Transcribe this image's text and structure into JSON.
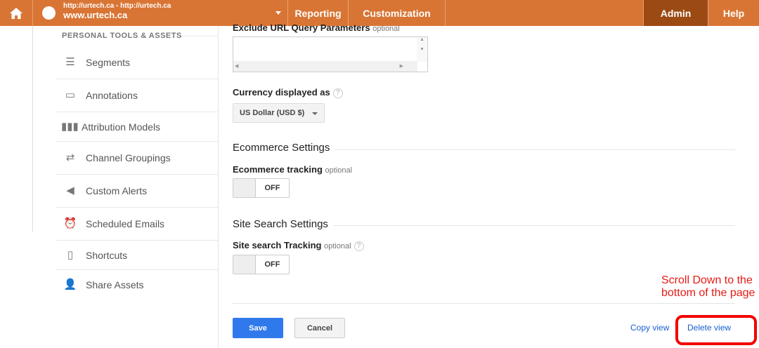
{
  "topbar": {
    "account_line1": "http://urtech.ca - http://urtech.ca",
    "account_line2": "www.urtech.ca",
    "nav": [
      "Reporting",
      "Customization",
      "Admin",
      "Help"
    ],
    "accent_color": "#d97534",
    "active_color": "#9c4a14"
  },
  "sidebar": {
    "heading": "PERSONAL TOOLS & ASSETS",
    "items": [
      {
        "label": "Segments",
        "icon": "segments-icon"
      },
      {
        "label": "Annotations",
        "icon": "comment-icon"
      },
      {
        "label": "Attribution Models",
        "icon": "bar-chart-icon"
      },
      {
        "label": "Channel Groupings",
        "icon": "channel-icon"
      },
      {
        "label": "Custom Alerts",
        "icon": "megaphone-icon"
      },
      {
        "label": "Scheduled Emails",
        "icon": "alarm-clock-icon"
      },
      {
        "label": "Shortcuts",
        "icon": "document-icon"
      },
      {
        "label": "Share Assets",
        "icon": "add-user-icon"
      }
    ]
  },
  "main": {
    "exclude_label": "Exclude URL Query Parameters",
    "optional": "optional",
    "currency_label": "Currency displayed as",
    "currency_value": "US Dollar (USD $)",
    "ecommerce_section": "Ecommerce Settings",
    "ecommerce_label": "Ecommerce tracking",
    "ecommerce_state": "OFF",
    "sitesearch_section": "Site Search Settings",
    "sitesearch_label": "Site search Tracking",
    "sitesearch_state": "OFF",
    "help": "?",
    "save": "Save",
    "cancel": "Cancel",
    "copy_view": "Copy view",
    "delete_view": "Delete view"
  },
  "annotation": {
    "line1": "Scroll Down to the",
    "line2": "bottom of the page",
    "color": "#e41b17"
  }
}
